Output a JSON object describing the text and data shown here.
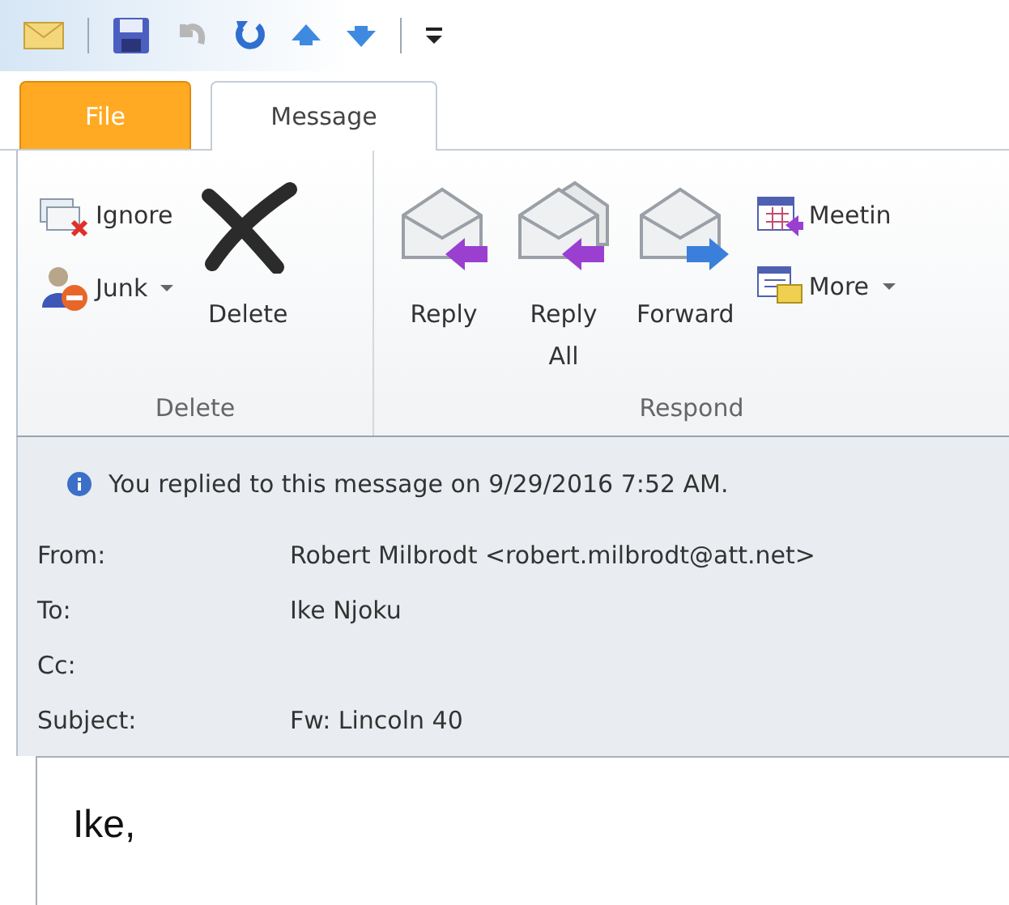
{
  "tabs": [
    {
      "label": "File",
      "kind": "file",
      "selected": false
    },
    {
      "label": "Message",
      "kind": "normal",
      "selected": true
    }
  ],
  "ribbon": {
    "groups": [
      {
        "label": "Delete",
        "columns": [
          {
            "kind": "small",
            "buttons": [
              {
                "label": "Ignore",
                "dropdown": false
              },
              {
                "label": "Junk",
                "dropdown": true
              }
            ]
          },
          {
            "kind": "large",
            "buttons": [
              {
                "label": "Delete",
                "dropdown": false
              }
            ]
          }
        ]
      },
      {
        "label": "Respond",
        "columns": [
          {
            "kind": "large",
            "buttons": [
              {
                "label": "Reply",
                "dropdown": false
              }
            ]
          },
          {
            "kind": "large",
            "buttons": [
              {
                "label": "Reply All",
                "dropdown": false
              }
            ]
          },
          {
            "kind": "large",
            "buttons": [
              {
                "label": "Forward",
                "dropdown": false
              }
            ]
          },
          {
            "kind": "small",
            "buttons": [
              {
                "label": "Meetin",
                "dropdown": false
              },
              {
                "label": "More",
                "dropdown": true
              }
            ]
          }
        ]
      }
    ]
  },
  "info": "You replied to this message on 9/29/2016 7:52 AM.",
  "fields": [
    {
      "label": "From:",
      "value": "Robert Milbrodt <robert.milbrodt@att.net>"
    },
    {
      "label": "To:",
      "value": "Ike Njoku"
    },
    {
      "label": "Cc:"
    },
    {
      "label": "Subject:",
      "value": "Fw: Lincoln 40"
    }
  ],
  "body": "Ike,"
}
